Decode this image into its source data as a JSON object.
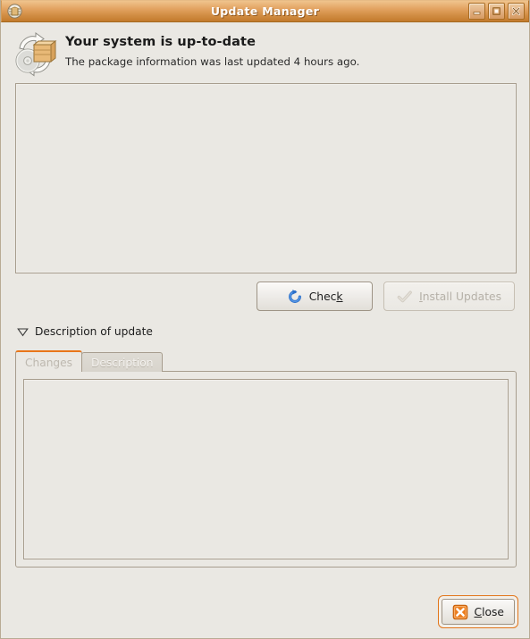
{
  "window": {
    "title": "Update Manager",
    "titlebar_icon": "update-manager-icon",
    "controls": [
      {
        "name": "minimize-button",
        "glyph": "minimize-icon"
      },
      {
        "name": "maximize-button",
        "glyph": "maximize-icon"
      },
      {
        "name": "close-window-button",
        "glyph": "close-icon"
      }
    ]
  },
  "header": {
    "icon": "package-update-icon",
    "title": "Your system is up-to-date",
    "subtitle": "The package information was last updated 4 hours ago."
  },
  "package_list": {
    "items": [],
    "empty": true
  },
  "actions": {
    "check": {
      "label_before": "Chec",
      "label_mnemonic": "k",
      "label_after": "",
      "icon": "refresh-icon",
      "enabled": true
    },
    "install_updates": {
      "label_before": "",
      "label_mnemonic": "I",
      "label_after": "nstall Updates",
      "icon": "checkmark-icon",
      "enabled": false
    }
  },
  "expander": {
    "label": "Description of update",
    "expanded": true,
    "icon": "triangle-down-icon"
  },
  "notebook": {
    "tabs": [
      {
        "label": "Changes",
        "active": true
      },
      {
        "label": "Description",
        "active": false
      }
    ],
    "content": ""
  },
  "footer": {
    "close": {
      "label_before": "",
      "label_mnemonic": "C",
      "label_after": "lose",
      "icon": "close-x-icon",
      "focused": true
    }
  },
  "colors": {
    "window_background": "#eae8e3",
    "titlebar_accent": "#d08c42",
    "tab_active_indicator": "#e8761a",
    "focus_ring": "#e2761b",
    "check_icon_blue": "#2b6fc9",
    "close_icon_orange": "#e8761a",
    "frame_border": "#a79d8e"
  }
}
